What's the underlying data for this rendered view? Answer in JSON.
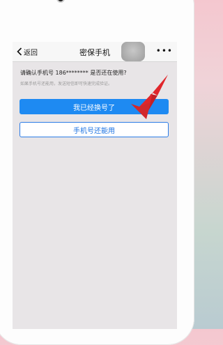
{
  "header": {
    "back_label": "返回",
    "title": "密保手机",
    "more_label": "•••"
  },
  "content": {
    "question": "请确认手机号 186******** 是否还在使用?",
    "hint": "如果手机号还能用，发送短信即可快速完成验证。"
  },
  "buttons": {
    "changed_label": "我已经换号了",
    "still_usable_label": "手机号还能用"
  },
  "colors": {
    "primary": "#1e8af2",
    "secondary_text": "#1e74e3",
    "arrow": "#e0262b"
  }
}
